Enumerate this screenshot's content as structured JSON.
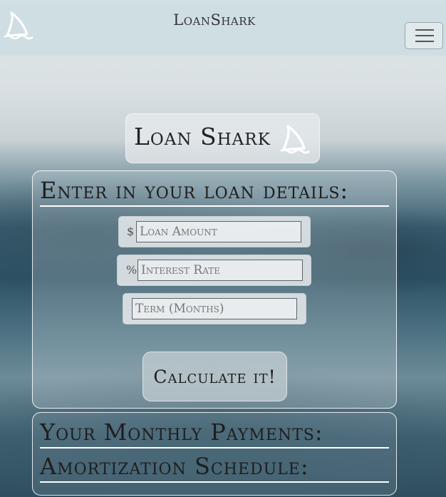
{
  "navbar": {
    "brand_name": "LoanShark",
    "logo_icon": "shark-fin-icon",
    "menu_icon": "hamburger-menu-icon"
  },
  "title_card": {
    "title": "Loan Shark",
    "icon": "shark-fin-icon"
  },
  "loan_form": {
    "heading": "Enter in your loan details:",
    "amount": {
      "prefix": "$",
      "placeholder": "Loan Amount",
      "value": ""
    },
    "rate": {
      "prefix": "%",
      "placeholder": "Interest Rate",
      "value": ""
    },
    "term": {
      "placeholder": "Term (Months)",
      "value": ""
    },
    "submit_label": "Calculate it!"
  },
  "results": {
    "payments_heading": "Your Monthly Payments:",
    "schedule_heading": "Amortization Schedule:"
  },
  "colors": {
    "heading_text": "#1e1e1e",
    "underline": "#ffffff",
    "navbar_bg": "#cddde1"
  }
}
